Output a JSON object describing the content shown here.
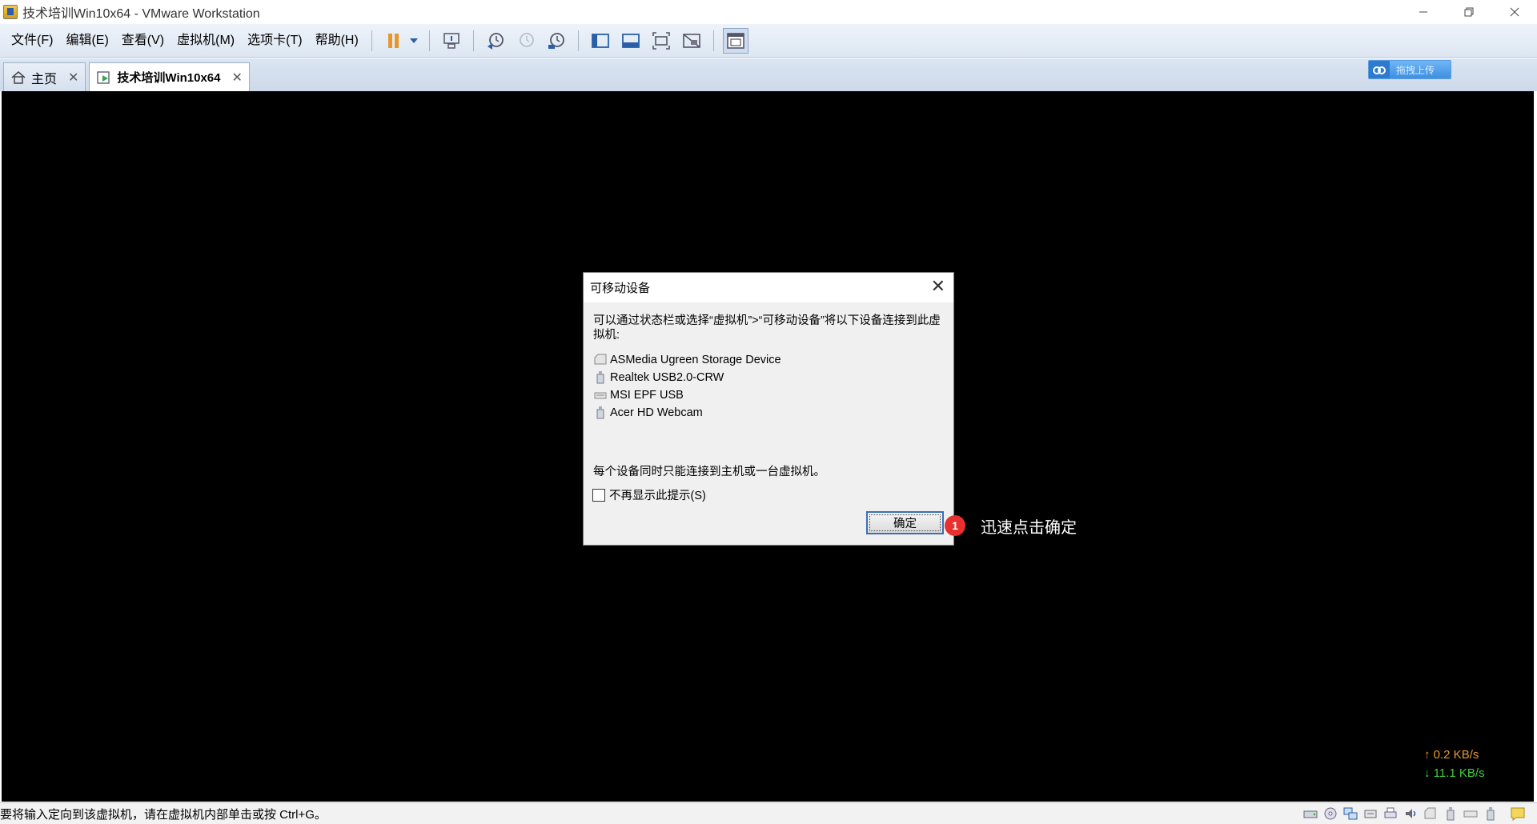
{
  "window": {
    "title": "技术培训Win10x64 - VMware Workstation"
  },
  "menu": {
    "items": [
      "文件(F)",
      "编辑(E)",
      "查看(V)",
      "虚拟机(M)",
      "选项卡(T)",
      "帮助(H)"
    ]
  },
  "tabs": [
    {
      "label": "主页",
      "active": false
    },
    {
      "label": "技术培训Win10x64",
      "active": true
    }
  ],
  "upload_button": {
    "label": "拖拽上传"
  },
  "dialog": {
    "title": "可移动设备",
    "message": "可以通过状态栏或选择“虚拟机”>“可移动设备”将以下设备连接到此虚拟机:",
    "devices": [
      "ASMedia Ugreen Storage Device",
      "Realtek USB2.0-CRW",
      "MSI EPF USB",
      "Acer HD Webcam"
    ],
    "note": "每个设备同时只能连接到主机或一台虚拟机。",
    "checkbox_label": "不再显示此提示(S)",
    "checkbox_checked": false,
    "ok_label": "确定"
  },
  "annotation": {
    "badge": "1",
    "text": "迅速点击确定",
    "badge_color": "#e8302e"
  },
  "network": {
    "upload": "↑ 0.2 KB/s",
    "download": "↓ 11.1 KB/s",
    "upload_color": "#e89a2a",
    "download_color": "#3fd13f"
  },
  "statusbar": {
    "message": "要将输入定向到该虚拟机，请在虚拟机内部单击或按 Ctrl+G。"
  }
}
